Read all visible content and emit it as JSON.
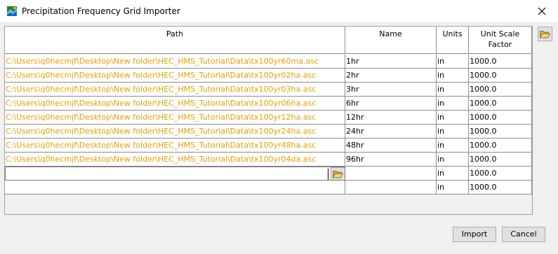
{
  "window": {
    "title": "Precipitation Frequency Grid Importer"
  },
  "table": {
    "columns": {
      "path": "Path",
      "name": "Name",
      "units": "Units",
      "factor_line1": "Unit Scale",
      "factor_line2": "Factor"
    },
    "rows": [
      {
        "path": "C:\\Users\\q0hecmjf\\Desktop\\New folder\\HEC_HMS_Tutorial\\Data\\tx100yr60ma.asc",
        "name": "1hr",
        "units": "in",
        "factor": "1000.0"
      },
      {
        "path": "C:\\Users\\q0hecmjf\\Desktop\\New folder\\HEC_HMS_Tutorial\\Data\\tx100yr02ha.asc",
        "name": "2hr",
        "units": "in",
        "factor": "1000.0"
      },
      {
        "path": "C:\\Users\\q0hecmjf\\Desktop\\New folder\\HEC_HMS_Tutorial\\Data\\tx100yr03ha.asc",
        "name": "3hr",
        "units": "in",
        "factor": "1000.0"
      },
      {
        "path": "C:\\Users\\q0hecmjf\\Desktop\\New folder\\HEC_HMS_Tutorial\\Data\\tx100yr06ha.asc",
        "name": "6hr",
        "units": "in",
        "factor": "1000.0"
      },
      {
        "path": "C:\\Users\\q0hecmjf\\Desktop\\New folder\\HEC_HMS_Tutorial\\Data\\tx100yr12ha.asc",
        "name": "12hr",
        "units": "in",
        "factor": "1000.0"
      },
      {
        "path": "C:\\Users\\q0hecmjf\\Desktop\\New folder\\HEC_HMS_Tutorial\\Data\\tx100yr24ha.asc",
        "name": "24hr",
        "units": "in",
        "factor": "1000.0"
      },
      {
        "path": "C:\\Users\\q0hecmjf\\Desktop\\New folder\\HEC_HMS_Tutorial\\Data\\tx100yr48ha.asc",
        "name": "48hr",
        "units": "in",
        "factor": "1000.0"
      },
      {
        "path": "C:\\Users\\q0hecmjf\\Desktop\\New folder\\HEC_HMS_Tutorial\\Data\\tx100yr04da.asc",
        "name": "96hr",
        "units": "in",
        "factor": "1000.0"
      }
    ],
    "editing_row": {
      "path": "",
      "name": "",
      "units": "in",
      "factor": "1000.0"
    },
    "blank_row": {
      "path": "",
      "name": "",
      "units": "in",
      "factor": "1000.0"
    }
  },
  "buttons": {
    "import": "Import",
    "cancel": "Cancel"
  },
  "icons": {
    "app": "grid-app-icon",
    "close": "close-icon",
    "browse": "folder-open-icon"
  }
}
